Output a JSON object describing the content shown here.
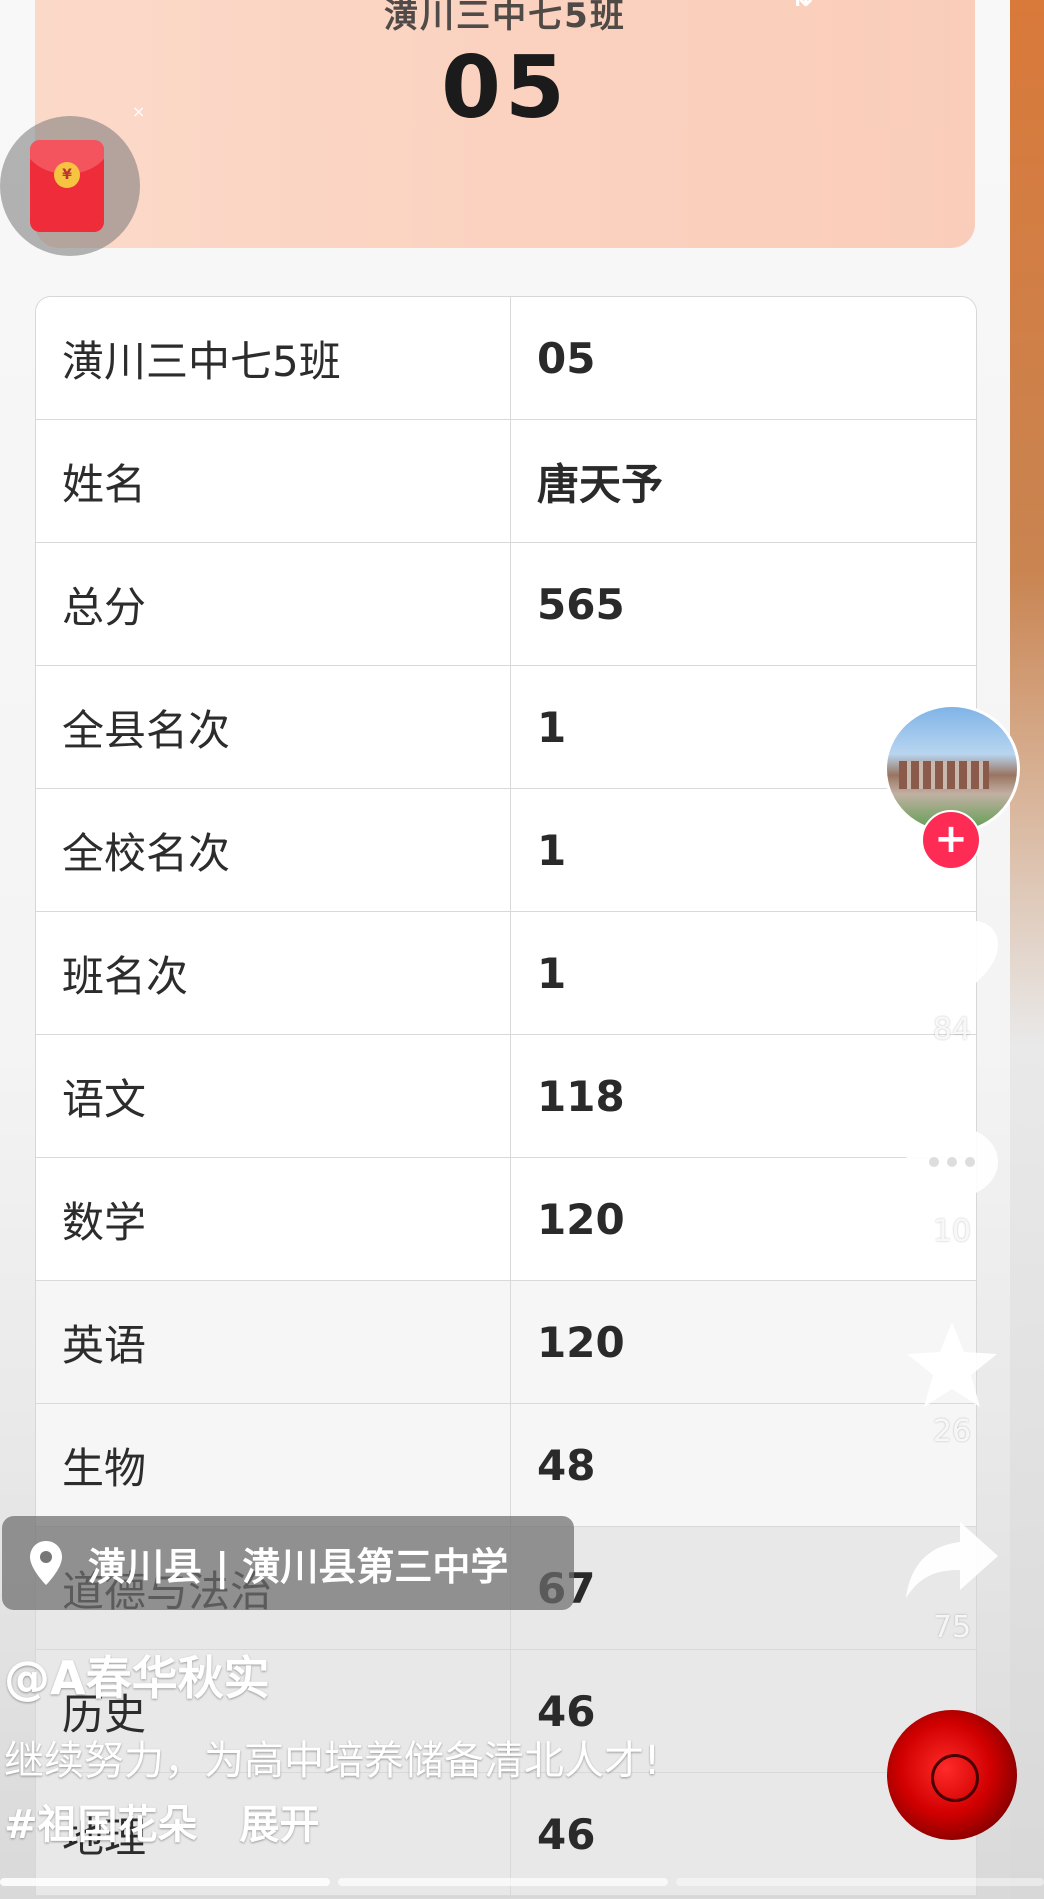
{
  "header": {
    "title": "潢川三中七5班",
    "code": "05",
    "close_glyph": "×"
  },
  "table": {
    "rows": [
      {
        "label": "潢川三中七5班",
        "value": "05"
      },
      {
        "label": "姓名",
        "value": "唐天予"
      },
      {
        "label": "总分",
        "value": "565"
      },
      {
        "label": "全县名次",
        "value": "1"
      },
      {
        "label": "全校名次",
        "value": "1"
      },
      {
        "label": "班名次",
        "value": "1"
      },
      {
        "label": "语文",
        "value": "118"
      },
      {
        "label": "数学",
        "value": "120"
      },
      {
        "label": "英语",
        "value": "120"
      },
      {
        "label": "生物",
        "value": "48"
      },
      {
        "label": "道德与法治",
        "value": "67"
      },
      {
        "label": "历史",
        "value": "46"
      },
      {
        "label": "地理",
        "value": "46"
      }
    ]
  },
  "actions": {
    "like_count": "84",
    "comment_count": "10",
    "favorite_count": "26",
    "share_count": "75",
    "follow_glyph": "+"
  },
  "location": {
    "text": "潢川县 | 潢川县第三中学"
  },
  "caption": {
    "user": "@A春华秋实",
    "text": "继续努力，为高中培养储备清北人才!",
    "hashtag": "#祖国花朵",
    "expand": "展开"
  },
  "colors": {
    "header_bg": "#fbd5c4",
    "follow_button": "#fe2c55",
    "red_packet": "#ef2c3a"
  },
  "icons": [
    "red-packet-icon",
    "heart-icon",
    "comment-icon",
    "star-icon",
    "share-icon",
    "location-pin-icon",
    "music-disc-icon"
  ]
}
